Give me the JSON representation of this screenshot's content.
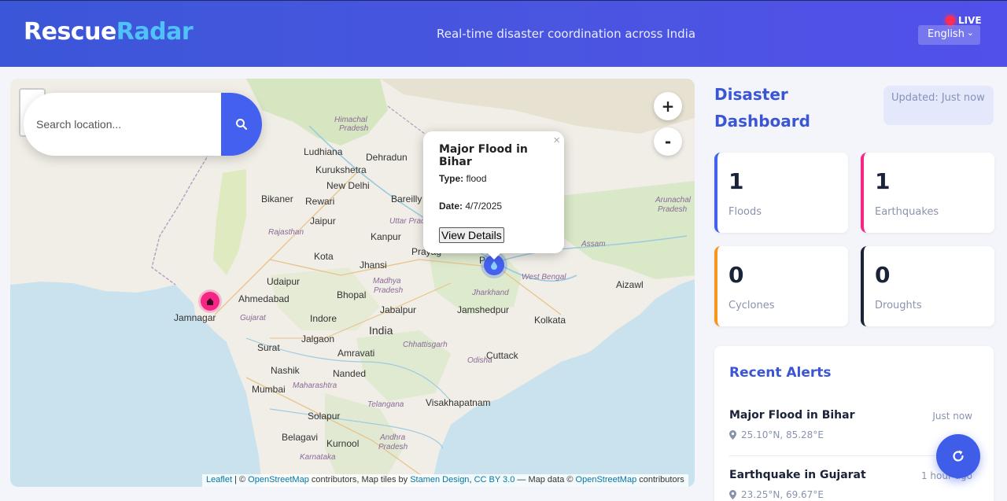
{
  "header": {
    "logo_part1": "Rescue",
    "logo_part2": "Radar",
    "tagline": "Real-time disaster coordination across India",
    "live_label": "LIVE",
    "language": "English"
  },
  "map": {
    "search_placeholder": "Search location...",
    "zoom_in": "+",
    "zoom_out": "-",
    "popup": {
      "title": "Major Flood in Bihar",
      "type_label": "Type:",
      "type_value": "flood",
      "date_label": "Date:",
      "date_value": "4/7/2025",
      "button": "View Details",
      "close": "×"
    },
    "labels": {
      "himachal": "Himachal",
      "pradesh": "Pradesh",
      "ludhiana": "Ludhiana",
      "dehradun": "Dehradun",
      "kurukshetra": "Kurukshetra",
      "new_delhi": "New Delhi",
      "bikaner": "Bikaner",
      "rewari": "Rewari",
      "bareilly": "Bareilly",
      "jaipur": "Jaipur",
      "uttar": "Uttar Prad",
      "rajasthan": "Rajasthan",
      "kanpur": "Kanpur",
      "prayagraj": "Prayag",
      "kota": "Kota",
      "jhansi": "Jhansi",
      "udaipur": "Udaipur",
      "madhya": "Madhya",
      "madhya2": "Pradesh",
      "bhopal": "Bhopal",
      "ahmedabad": "Ahmedabad",
      "jamnagar": "Jamnagar",
      "gujarat": "Gujarat",
      "indore": "Indore",
      "jabalpur": "Jabalpur",
      "india": "India",
      "jharkhand": "Jharkhand",
      "jamshedpur": "Jamshedpur",
      "kolkata": "Kolkata",
      "west_bengal": "West Bengal",
      "assam": "Assam",
      "arunachal": "Arunachal",
      "arunachal2": "Pradesh",
      "aizawl": "Aizawl",
      "surat": "Surat",
      "jalgaon": "Jalgaon",
      "amravati": "Amravati",
      "chhattisgarh": "Chhattisgarh",
      "cuttack": "Cuttack",
      "odisha": "Odisha",
      "nashik": "Nashik",
      "nanded": "Nanded",
      "mumbai": "Mumbai",
      "maharashtra": "Maharashtra",
      "telangana": "Telangana",
      "visakhapatnam": "Visakhapatnam",
      "solapur": "Solapur",
      "belagavi": "Belagavi",
      "kurnool": "Kurnool",
      "andhra": "Andhra",
      "andhra2": "Pradesh",
      "karnataka": "Karnataka",
      "p": "P"
    },
    "attribution": {
      "leaflet": "Leaflet",
      "sep1": " | © ",
      "osm1": "OpenStreetMap",
      "text1": " contributors, Map tiles by ",
      "stamen": "Stamen Design",
      "comma": ", ",
      "cc": "CC BY 3.0",
      "text2": " — Map data © ",
      "osm2": "OpenStreetMap",
      "text3": " contributors"
    }
  },
  "dashboard": {
    "title": "Disaster Dashboard",
    "updated": "Updated: Just now",
    "cards": [
      {
        "count": "1",
        "label": "Floods",
        "color": "#4361ee"
      },
      {
        "count": "1",
        "label": "Earthquakes",
        "color": "#f72585"
      },
      {
        "count": "0",
        "label": "Cyclones",
        "color": "#f8961e"
      },
      {
        "count": "0",
        "label": "Droughts",
        "color": "#1b2338"
      }
    ],
    "alerts_title": "Recent Alerts",
    "alerts": [
      {
        "title": "Major Flood in Bihar",
        "time": "Just now",
        "coords": "25.10°N, 85.28°E"
      },
      {
        "title": "Earthquake in Gujarat",
        "time": "1 hour ago",
        "coords": "23.25°N, 69.67°E"
      }
    ]
  }
}
